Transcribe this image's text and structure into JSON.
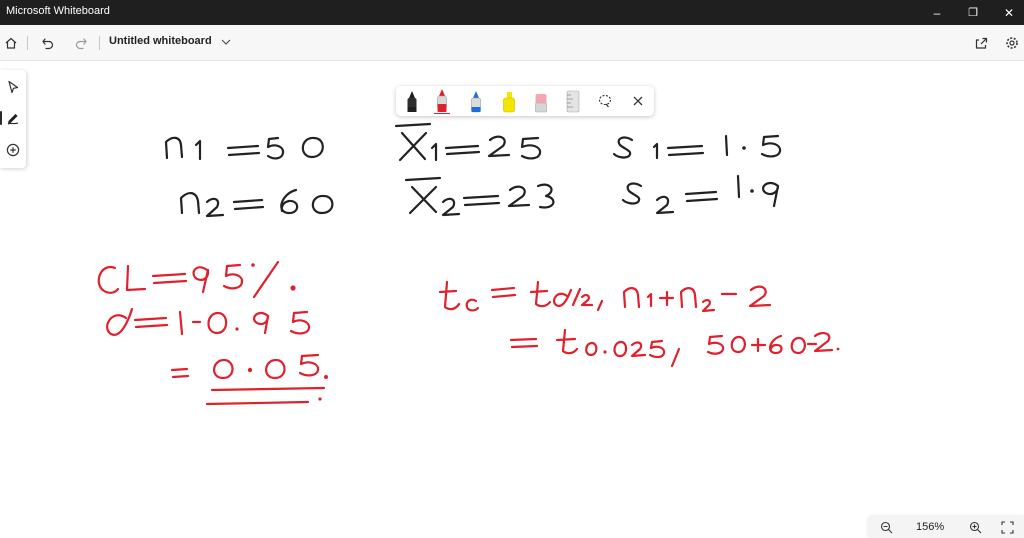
{
  "window": {
    "title": "Microsoft Whiteboard",
    "minimize_glyph": "–",
    "restore_glyph": "❐",
    "close_glyph": "✕"
  },
  "toolbar": {
    "board_title": "Untitled whiteboard",
    "icons": [
      "home-icon",
      "undo-icon",
      "redo-icon",
      "chevron-down-icon",
      "share-icon",
      "settings-icon"
    ]
  },
  "sidebar": {
    "items": [
      "select-icon",
      "pen-icon",
      "add-icon"
    ],
    "active": "pen-icon"
  },
  "ink_tray": {
    "pens": [
      {
        "name": "black-pen",
        "color": "#1f1f1f"
      },
      {
        "name": "red-pen",
        "color": "#e0202c",
        "selected": true
      },
      {
        "name": "blue-pen",
        "color": "#1a6fd8"
      },
      {
        "name": "highlighter-yellow",
        "color": "#f2e600"
      },
      {
        "name": "eraser",
        "color": "#f2a7b0"
      },
      {
        "name": "ruler",
        "color": "#c8c8c8"
      }
    ],
    "lasso_icon": "lasso-icon",
    "close_icon": "close-icon"
  },
  "colors": {
    "ink_black": "#222222",
    "ink_red": "#e0202c",
    "titlebar_bg": "#1f1f1f"
  },
  "zoom": {
    "level": "156%",
    "out_icon": "zoom-out-icon",
    "in_icon": "zoom-in-icon",
    "fit_icon": "fit-to-screen-icon"
  }
}
